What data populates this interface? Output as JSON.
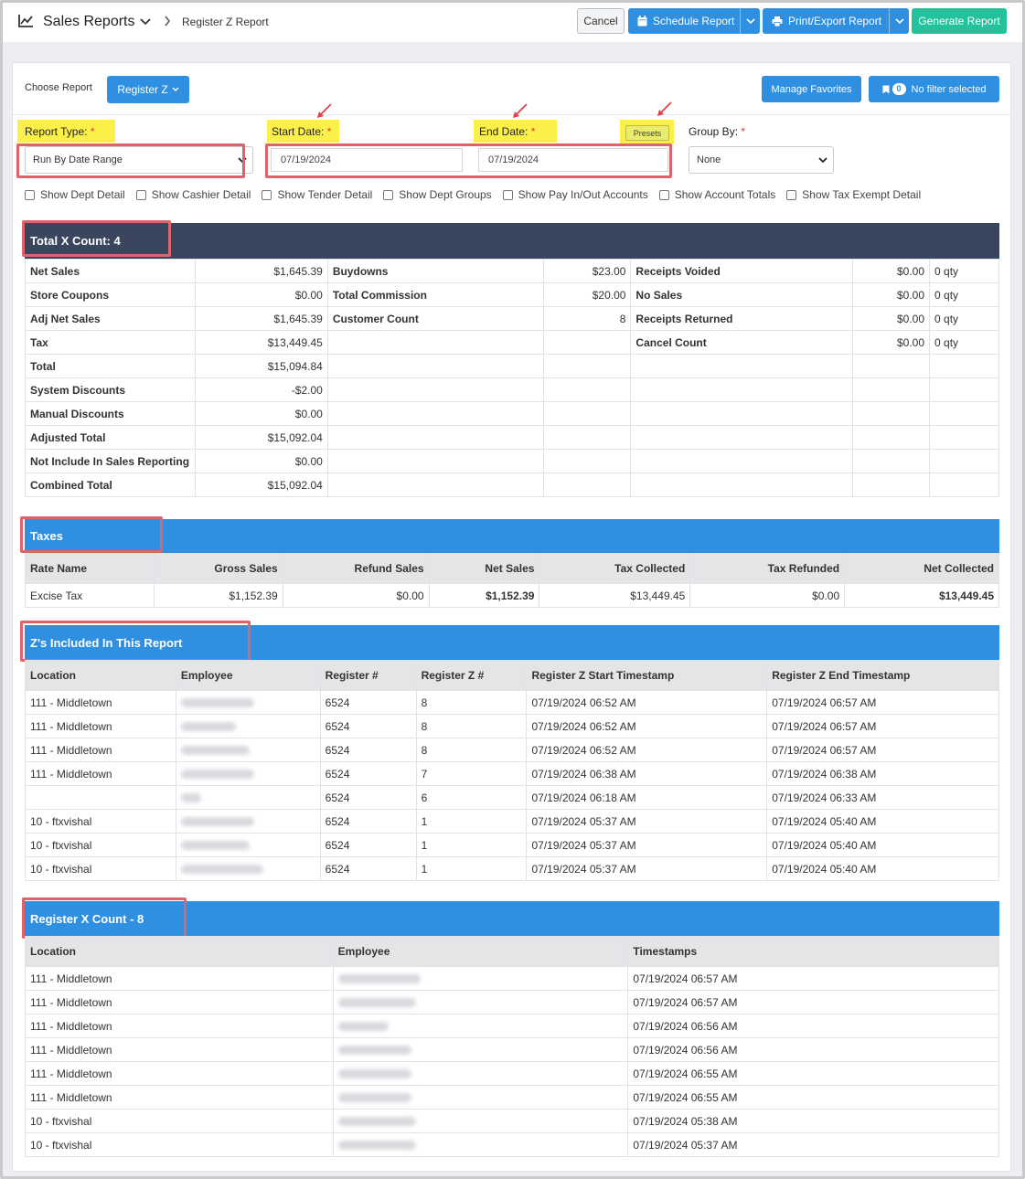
{
  "topbar": {
    "title": "Sales Reports",
    "subtitle": "Register Z Report",
    "cancel": "Cancel",
    "schedule": "Schedule Report",
    "print": "Print/Export Report",
    "generate": "Generate Report"
  },
  "toolbar": {
    "choose_label": "Choose Report",
    "report_button": "Register Z",
    "manage_favorites": "Manage Favorites",
    "filter_count": "0",
    "filter_text": "No filter selected"
  },
  "form": {
    "report_type_label": "Report Type:",
    "report_type_value": "Run By Date Range",
    "start_label": "Start Date:",
    "start_value": "07/19/2024",
    "end_label": "End Date:",
    "end_value": "07/19/2024",
    "presets": "Presets",
    "group_label": "Group By:",
    "group_value": "None",
    "required_mark": "*"
  },
  "options": [
    "Show Dept Detail",
    "Show Cashier Detail",
    "Show Tender Detail",
    "Show Dept Groups",
    "Show Pay In/Out Accounts",
    "Show Account Totals",
    "Show Tax Exempt Detail"
  ],
  "xcount": {
    "title": "Total X Count: 4",
    "rows": [
      [
        "Net Sales",
        "$1,645.39",
        "Buydowns",
        "$23.00",
        "Receipts Voided",
        "$0.00",
        "0 qty"
      ],
      [
        "Store Coupons",
        "$0.00",
        "Total Commission",
        "$20.00",
        "No Sales",
        "$0.00",
        "0 qty"
      ],
      [
        "Adj Net Sales",
        "$1,645.39",
        "Customer Count",
        "8",
        "Receipts Returned",
        "$0.00",
        "0 qty"
      ],
      [
        "Tax",
        "$13,449.45",
        "",
        "",
        "Cancel Count",
        "$0.00",
        "0 qty"
      ],
      [
        "Total",
        "$15,094.84",
        "",
        "",
        "",
        "",
        ""
      ],
      [
        "System Discounts",
        "-$2.00",
        "",
        "",
        "",
        "",
        ""
      ],
      [
        "Manual Discounts",
        "$0.00",
        "",
        "",
        "",
        "",
        ""
      ],
      [
        "Adjusted Total",
        "$15,092.04",
        "",
        "",
        "",
        "",
        ""
      ],
      [
        "Not Include In Sales Reporting",
        "$0.00",
        "",
        "",
        "",
        "",
        ""
      ],
      [
        "Combined Total",
        "$15,092.04",
        "",
        "",
        "",
        "",
        ""
      ]
    ]
  },
  "taxes": {
    "title": "Taxes",
    "headers": [
      "Rate Name",
      "Gross Sales",
      "Refund Sales",
      "Net Sales",
      "Tax Collected",
      "Tax Refunded",
      "Net Collected"
    ],
    "rows": [
      [
        "Excise Tax",
        "$1,152.39",
        "$0.00",
        "$1,152.39",
        "$13,449.45",
        "$0.00",
        "$13,449.45"
      ]
    ]
  },
  "zs": {
    "title": "Z's Included In This Report",
    "headers": [
      "Location",
      "Employee",
      "Register #",
      "Register Z #",
      "Register Z Start Timestamp",
      "Register Z End Timestamp"
    ],
    "rows": [
      [
        "111 - Middletown",
        "",
        "6524",
        "8",
        "07/19/2024 06:52 AM",
        "07/19/2024 06:57 AM"
      ],
      [
        "111 - Middletown",
        "",
        "6524",
        "8",
        "07/19/2024 06:52 AM",
        "07/19/2024 06:57 AM"
      ],
      [
        "111 - Middletown",
        "",
        "6524",
        "8",
        "07/19/2024 06:52 AM",
        "07/19/2024 06:57 AM"
      ],
      [
        "111 - Middletown",
        "",
        "6524",
        "7",
        "07/19/2024 06:38 AM",
        "07/19/2024 06:38 AM"
      ],
      [
        "",
        "",
        "6524",
        "6",
        "07/19/2024 06:18 AM",
        "07/19/2024 06:33 AM"
      ],
      [
        "10 - ftxvishal",
        "",
        "6524",
        "1",
        "07/19/2024 05:37 AM",
        "07/19/2024 05:40 AM"
      ],
      [
        "10 - ftxvishal",
        "",
        "6524",
        "1",
        "07/19/2024 05:37 AM",
        "07/19/2024 05:40 AM"
      ],
      [
        "10 - ftxvishal",
        "",
        "6524",
        "1",
        "07/19/2024 05:37 AM",
        "07/19/2024 05:40 AM"
      ]
    ]
  },
  "registerx": {
    "title": "Register X Count - 8",
    "headers": [
      "Location",
      "Employee",
      "Timestamps"
    ],
    "rows": [
      [
        "111 - Middletown",
        "",
        "07/19/2024 06:57 AM"
      ],
      [
        "111 - Middletown",
        "",
        "07/19/2024 06:57 AM"
      ],
      [
        "111 - Middletown",
        "",
        "07/19/2024 06:56 AM"
      ],
      [
        "111 - Middletown",
        "",
        "07/19/2024 06:56 AM"
      ],
      [
        "111 - Middletown",
        "",
        "07/19/2024 06:55 AM"
      ],
      [
        "111 - Middletown",
        "",
        "07/19/2024 06:55 AM"
      ],
      [
        "10 - ftxvishal",
        "",
        "07/19/2024 05:38 AM"
      ],
      [
        "10 - ftxvishal",
        "",
        "07/19/2024 05:37 AM"
      ]
    ]
  },
  "colors": {
    "primary": "#2f8fe0",
    "success": "#23c29c",
    "dark_header": "#39465e",
    "highlight": "#fbf04a",
    "annotation": "#e0636b"
  },
  "icons": [
    "chart-line-icon",
    "chevron-down-icon",
    "chevron-right-icon",
    "calendar-icon",
    "printer-icon",
    "bookmark-icon",
    "arrow-annotation-icon"
  ]
}
